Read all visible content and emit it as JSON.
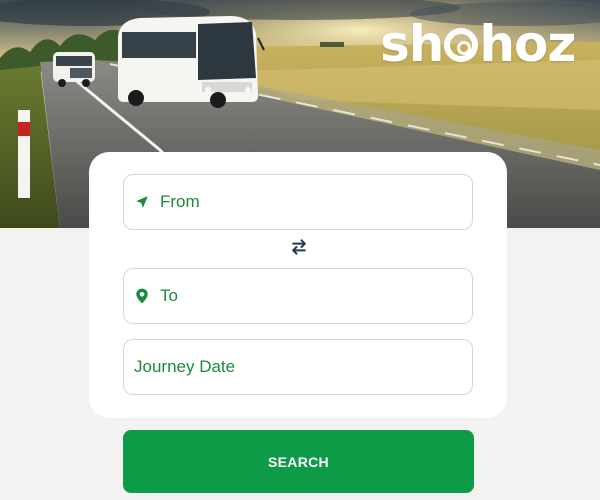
{
  "brand": {
    "logo_text_before": "sh",
    "logo_text_after": "hoz",
    "accent_color": "#0e9b48",
    "text_green": "#1a8b3c"
  },
  "search_form": {
    "from": {
      "label": "From",
      "icon": "navigation-arrow-icon"
    },
    "swap": {
      "icon": "swap-arrows-icon"
    },
    "to": {
      "label": "To",
      "icon": "location-pin-icon"
    },
    "journey_date": {
      "label": "Journey Date"
    },
    "search_button_label": "SEARCH"
  }
}
